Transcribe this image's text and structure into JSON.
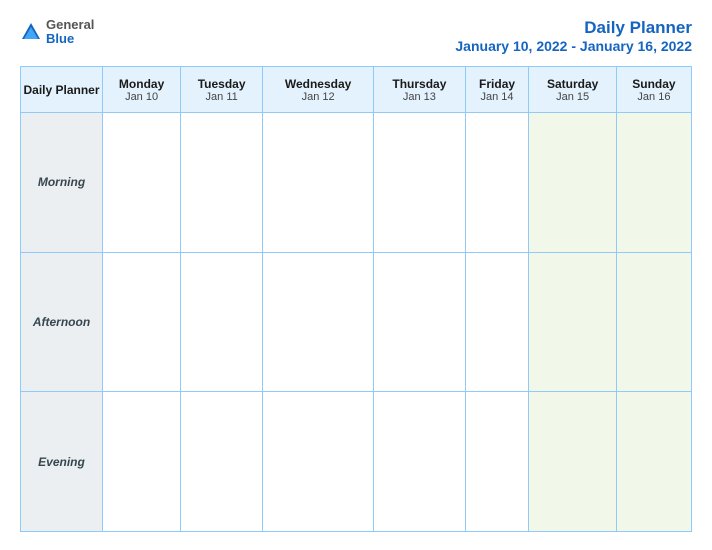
{
  "logo": {
    "general": "General",
    "blue": "Blue"
  },
  "header": {
    "title": "Daily Planner",
    "date_range": "January 10, 2022 - January 16, 2022"
  },
  "table": {
    "label_header": "Daily Planner",
    "columns": [
      {
        "day": "Monday",
        "date": "Jan 10"
      },
      {
        "day": "Tuesday",
        "date": "Jan 11"
      },
      {
        "day": "Wednesday",
        "date": "Jan 12"
      },
      {
        "day": "Thursday",
        "date": "Jan 13"
      },
      {
        "day": "Friday",
        "date": "Jan 14"
      },
      {
        "day": "Saturday",
        "date": "Jan 15"
      },
      {
        "day": "Sunday",
        "date": "Jan 16"
      }
    ],
    "rows": [
      {
        "label": "Morning"
      },
      {
        "label": "Afternoon"
      },
      {
        "label": "Evening"
      }
    ]
  }
}
